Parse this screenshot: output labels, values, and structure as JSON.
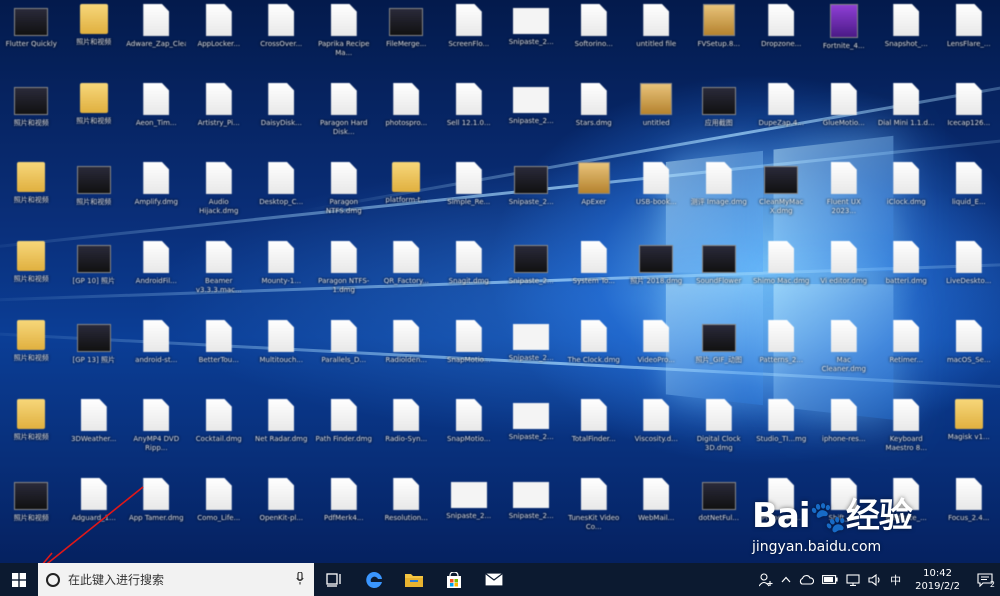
{
  "desktop": {
    "rows": [
      [
        {
          "type": "app",
          "label": "Flutter Quickly"
        },
        {
          "type": "folder",
          "label": "照片和视频"
        },
        {
          "type": "file",
          "label": "Adware_Zap_Cleaner_2..."
        },
        {
          "type": "file",
          "label": "AppLocker..."
        },
        {
          "type": "file",
          "label": "CrossOver..."
        },
        {
          "type": "file",
          "label": "Paprika Recipe Ma..."
        },
        {
          "type": "app",
          "label": "FileMerge..."
        },
        {
          "type": "file",
          "label": "ScreenFlo..."
        },
        {
          "type": "sheet",
          "label": "Snipaste_2..."
        },
        {
          "type": "file",
          "label": "Softorino..."
        },
        {
          "type": "file",
          "label": "untitled file"
        },
        {
          "type": "box",
          "label": "FVSetup.8..."
        },
        {
          "type": "file",
          "label": "Dropzone..."
        },
        {
          "type": "purple",
          "label": "Fortnite_4..."
        },
        {
          "type": "file",
          "label": "Snapshot_..."
        },
        {
          "type": "file",
          "label": "LensFlare_..."
        }
      ],
      [
        {
          "type": "app",
          "label": "照片和视频"
        },
        {
          "type": "folder",
          "label": "照片和视频"
        },
        {
          "type": "file",
          "label": "Aeon_Tim..."
        },
        {
          "type": "file",
          "label": "Artistry_Pi..."
        },
        {
          "type": "file",
          "label": "DaisyDisk..."
        },
        {
          "type": "file",
          "label": "Paragon Hard Disk..."
        },
        {
          "type": "file",
          "label": "photospro..."
        },
        {
          "type": "file",
          "label": "Sell 12.1.0..."
        },
        {
          "type": "sheet",
          "label": "Snipaste_2..."
        },
        {
          "type": "file",
          "label": "Stars.dmg"
        },
        {
          "type": "box",
          "label": "untitled"
        },
        {
          "type": "app",
          "label": "应用截图"
        },
        {
          "type": "file",
          "label": "DupeZap.4..."
        },
        {
          "type": "file",
          "label": "GlueMotio..."
        },
        {
          "type": "file",
          "label": "Dial Mini 1.1.d..."
        },
        {
          "type": "file",
          "label": "Icecap126..."
        }
      ],
      [
        {
          "type": "folder",
          "label": "照片和视频"
        },
        {
          "type": "app",
          "label": "照片和视频"
        },
        {
          "type": "file",
          "label": "Amplify.dmg"
        },
        {
          "type": "file",
          "label": "Audio Hijack.dmg"
        },
        {
          "type": "file",
          "label": "Desktop_C..."
        },
        {
          "type": "file",
          "label": "Paragon NTFS.dmg"
        },
        {
          "type": "folder",
          "label": "platform-t..."
        },
        {
          "type": "file",
          "label": "Simple_Re..."
        },
        {
          "type": "app",
          "label": "Snipaste_2..."
        },
        {
          "type": "box",
          "label": "ApExer"
        },
        {
          "type": "file",
          "label": "USB-book..."
        },
        {
          "type": "file",
          "label": "测评 Image.dmg"
        },
        {
          "type": "app",
          "label": "CleanMyMac X.dmg"
        },
        {
          "type": "file",
          "label": "Fluent UX 2023..."
        },
        {
          "type": "file",
          "label": "iClock.dmg"
        },
        {
          "type": "file",
          "label": "liquid_E..."
        }
      ],
      [
        {
          "type": "folder",
          "label": "照片和视频"
        },
        {
          "type": "app",
          "label": "[GP 10] 照片"
        },
        {
          "type": "file",
          "label": "AndroidFil..."
        },
        {
          "type": "file",
          "label": "Beamer v3.3.3.mac..."
        },
        {
          "type": "file",
          "label": "Mounty-1..."
        },
        {
          "type": "file",
          "label": "Paragon NTFS-1.dmg"
        },
        {
          "type": "file",
          "label": "QR_Factory..."
        },
        {
          "type": "file",
          "label": "Snagit.dmg"
        },
        {
          "type": "app",
          "label": "Snipaste_2..."
        },
        {
          "type": "file",
          "label": "System To..."
        },
        {
          "type": "app",
          "label": "照片 2018.dmg"
        },
        {
          "type": "app",
          "label": "SoundFlower"
        },
        {
          "type": "file",
          "label": "Shimo Mac.dmg"
        },
        {
          "type": "file",
          "label": "Vi editor.dmg"
        },
        {
          "type": "file",
          "label": "batteri.dmg"
        },
        {
          "type": "file",
          "label": "LiveDeskto..."
        }
      ],
      [
        {
          "type": "folder",
          "label": "照片和视频"
        },
        {
          "type": "app",
          "label": "[GP 13] 照片"
        },
        {
          "type": "file",
          "label": "android-st..."
        },
        {
          "type": "file",
          "label": "BetterTou..."
        },
        {
          "type": "file",
          "label": "Multitouch..."
        },
        {
          "type": "file",
          "label": "Parallels_D..."
        },
        {
          "type": "file",
          "label": "Radiolden..."
        },
        {
          "type": "file",
          "label": "SnapMotio..."
        },
        {
          "type": "sheet",
          "label": "Snipaste_2..."
        },
        {
          "type": "file",
          "label": "The Clock.dmg"
        },
        {
          "type": "file",
          "label": "VideoPro..."
        },
        {
          "type": "app",
          "label": "照片_GIF_动图"
        },
        {
          "type": "file",
          "label": "Patterns_2..."
        },
        {
          "type": "file",
          "label": "Mac Cleaner.dmg"
        },
        {
          "type": "file",
          "label": "Retimer..."
        },
        {
          "type": "file",
          "label": "macOS_Se..."
        }
      ],
      [
        {
          "type": "folder",
          "label": "照片和视频"
        },
        {
          "type": "file",
          "label": "3DWeather..."
        },
        {
          "type": "file",
          "label": "AnyMP4 DVD Ripp..."
        },
        {
          "type": "file",
          "label": "Cocktail.dmg"
        },
        {
          "type": "file",
          "label": "Net Radar.dmg"
        },
        {
          "type": "file",
          "label": "Path Finder.dmg"
        },
        {
          "type": "file",
          "label": "Radio-Syn..."
        },
        {
          "type": "file",
          "label": "SnapMotio..."
        },
        {
          "type": "sheet",
          "label": "Snipaste_2..."
        },
        {
          "type": "file",
          "label": "TotalFinder..."
        },
        {
          "type": "file",
          "label": "Viscosity.d..."
        },
        {
          "type": "file",
          "label": "Digital Clock 3D.dmg"
        },
        {
          "type": "file",
          "label": "Studio_TI...mg"
        },
        {
          "type": "file",
          "label": "iphone-res..."
        },
        {
          "type": "file",
          "label": "Keyboard Maestro 8..."
        },
        {
          "type": "folder",
          "label": "Magisk v1..."
        }
      ],
      [
        {
          "type": "app",
          "label": "照片和视频"
        },
        {
          "type": "file",
          "label": "Adguard_1..."
        },
        {
          "type": "file",
          "label": "App Tamer.dmg"
        },
        {
          "type": "file",
          "label": "Como_Life..."
        },
        {
          "type": "file",
          "label": "OpenKit-pl..."
        },
        {
          "type": "file",
          "label": "PdfMerk4..."
        },
        {
          "type": "file",
          "label": "Resolution..."
        },
        {
          "type": "sheet",
          "label": "Snipaste_2..."
        },
        {
          "type": "sheet",
          "label": "Snipaste_2..."
        },
        {
          "type": "file",
          "label": "TunesKit Video Co..."
        },
        {
          "type": "file",
          "label": "WebMail..."
        },
        {
          "type": "app",
          "label": "dotNetFul..."
        },
        {
          "type": "file",
          "label": "Prime_10..."
        },
        {
          "type": "file",
          "label": "Shift_1..."
        },
        {
          "type": "file",
          "label": "Meditate_..."
        },
        {
          "type": "file",
          "label": "Focus_2.4..."
        }
      ]
    ]
  },
  "watermark": {
    "logo": "Bai",
    "logo_suffix": "经验",
    "url": "jingyan.baidu.com"
  },
  "taskbar": {
    "search_placeholder": "在此键入进行搜索",
    "ime": "中",
    "time": "10:42",
    "date": "2019/2/2",
    "notification_count": "2"
  },
  "colors": {
    "taskbar": "#0c1a30",
    "search_bg": "#f2f2f2",
    "arrow": "#e01818"
  }
}
